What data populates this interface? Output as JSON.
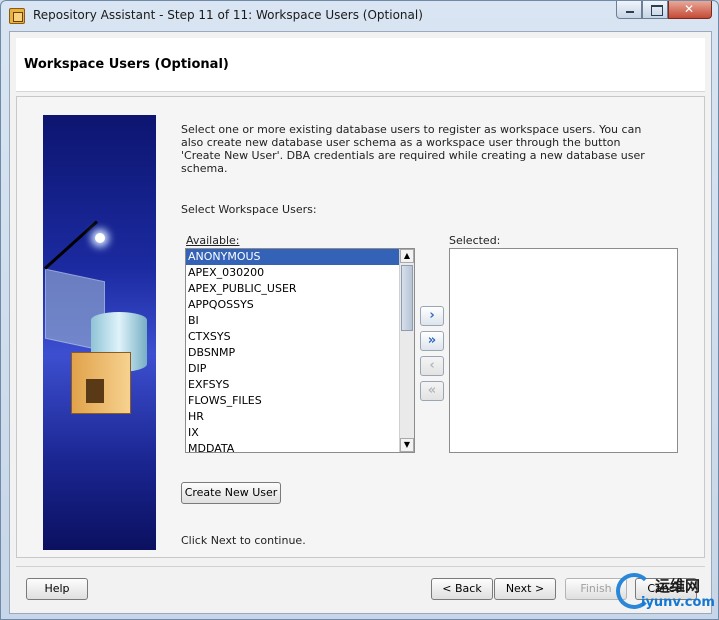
{
  "window": {
    "title": "Repository Assistant - Step 11 of 11: Workspace Users (Optional)"
  },
  "header": {
    "title": "Workspace Users (Optional)"
  },
  "intro_text": "Select one or more existing database users to register as workspace users. You can also create new database user schema as a workspace user through the button 'Create New User'. DBA credentials are required while creating a new database user schema.",
  "select_label": "Select Workspace Users:",
  "available": {
    "label": "Available:",
    "items": [
      "ANONYMOUS",
      "APEX_030200",
      "APEX_PUBLIC_USER",
      "APPQOSSYS",
      "BI",
      "CTXSYS",
      "DBSNMP",
      "DIP",
      "EXFSYS",
      "FLOWS_FILES",
      "HR",
      "IX",
      "MDDATA"
    ],
    "selected_index": 0
  },
  "selected": {
    "label": "Selected:",
    "items": []
  },
  "move_buttons": {
    "add": "›",
    "add_all": "»",
    "remove": "‹",
    "remove_all": "«"
  },
  "create_user_button": "Create New User",
  "continue_text": "Click Next to continue.",
  "footer": {
    "help": "Help",
    "back": "< Back",
    "next": "Next >",
    "finish": "Finish",
    "cancel": "Cancel"
  },
  "watermark": {
    "line1": "运维网",
    "line2": "iyunv.com"
  },
  "colors": {
    "selection": "#3462b7",
    "move_arrow": "#2f6ac4",
    "title_band": "#ffffff"
  },
  "icons": [
    "app-icon",
    "minimize-icon",
    "maximize-icon",
    "close-icon",
    "scroll-up-icon",
    "scroll-down-icon"
  ]
}
